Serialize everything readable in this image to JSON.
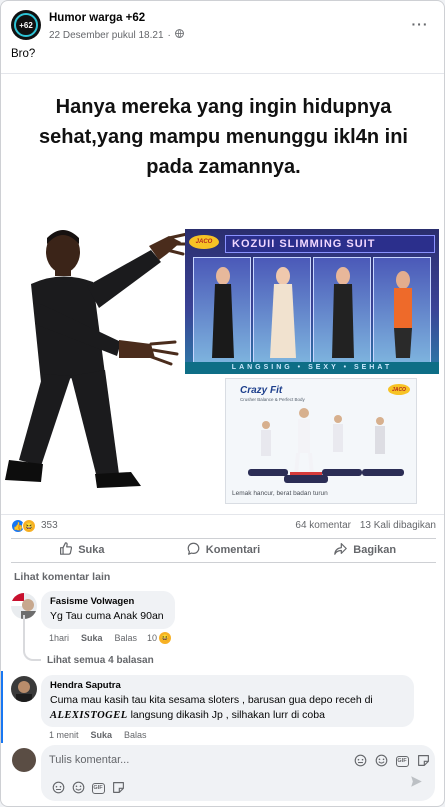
{
  "post": {
    "page_name": "Humor warga +62",
    "avatar_text": "+62",
    "timestamp": "22 Desember pukul 18.21",
    "caption": "Bro?"
  },
  "meme": {
    "title": "Hanya mereka yang ingin hidupnya sehat,yang mampu menunggu ikl4n ini pada zamannya.",
    "ad1_brand": "JACO",
    "ad1_title": "KOZUII SLIMMING SUIT",
    "ad1_tagline": "LANGSING • SEXY • SEHAT",
    "ad2_brand": "Crazy Fit",
    "ad2_sub": "Crusher Balance & Perfect Body",
    "ad2_logo": "JACO",
    "ad2_caption": "Lemak hancur, berat badan turun"
  },
  "stats": {
    "reaction_count": "353",
    "comments": "64 komentar",
    "shares": "13 Kali dibagikan"
  },
  "actions": {
    "like": "Suka",
    "comment": "Komentari",
    "share": "Bagikan"
  },
  "comments_section": {
    "see_more": "Lihat komentar lain",
    "replies_link": "Lihat semua 4 balasan",
    "items": [
      {
        "name": "Fasisme Volwagen",
        "text": "Yg Tau cuma Anak 90an",
        "time": "1hari",
        "like": "Suka",
        "reply": "Balas",
        "reactions": "10"
      },
      {
        "name": "Hendra Saputra",
        "text_pre": "Cuma mau kasih tau kita sesama sloters , barusan gua depo receh di",
        "text_brand": "ALEXISTOGEL",
        "text_post": " langsung dikasih Jp , silhakan lurr di coba",
        "time": "1 menit",
        "like": "Suka",
        "reply": "Balas"
      }
    ]
  },
  "composer": {
    "placeholder": "Tulis komentar..."
  },
  "colors": {
    "facebook_blue": "#1877f2",
    "text_secondary": "#65676b",
    "bubble_bg": "#f0f2f5"
  }
}
